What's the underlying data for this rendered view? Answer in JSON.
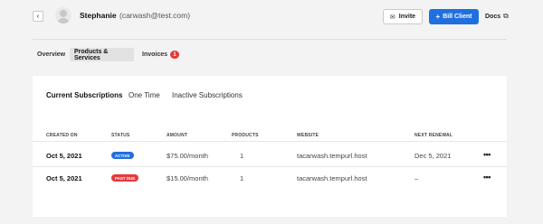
{
  "header": {
    "name": "Stephanie",
    "email": "(carwash@test.com)",
    "invite_label": "Invite",
    "bill_label": "Bill Client",
    "docs_label": "Docs"
  },
  "tabs": [
    {
      "label": "Overview"
    },
    {
      "label": "Products & Services",
      "active": true
    },
    {
      "label": "Invoices",
      "badge": "1"
    }
  ],
  "subtabs": [
    {
      "label": "Current Subscriptions",
      "active": true
    },
    {
      "label": "One Time"
    },
    {
      "label": "Inactive Subscriptions"
    }
  ],
  "table": {
    "columns": [
      "CREATED ON",
      "STATUS",
      "AMOUNT",
      "PRODUCTS",
      "WEBSITE",
      "NEXT RENEWAL"
    ],
    "rows": [
      {
        "created": "Oct 5, 2021",
        "status": "ACTIVE",
        "status_color": "#1f6fe0",
        "amount": "$75.00/month",
        "products": "1",
        "website": "tacarwash.tempurl.host",
        "renewal": "Dec 5, 2021",
        "menu": "•••"
      },
      {
        "created": "Oct 5, 2021",
        "status": "PAST DUE",
        "status_color": "#e5393c",
        "amount": "$15.00/month",
        "products": "1",
        "website": "tacarwash.tempurl.host",
        "renewal": "–",
        "menu": "•••"
      }
    ]
  },
  "colors": {
    "accent": "#1f6fe0",
    "danger": "#e5393c",
    "background": "#f3f3f3"
  },
  "icons": {
    "back": "chevron-left-icon",
    "invite": "envelope-icon",
    "bill": "plus-icon",
    "docs": "external-link-icon",
    "row_menu": "more-horizontal-icon"
  }
}
